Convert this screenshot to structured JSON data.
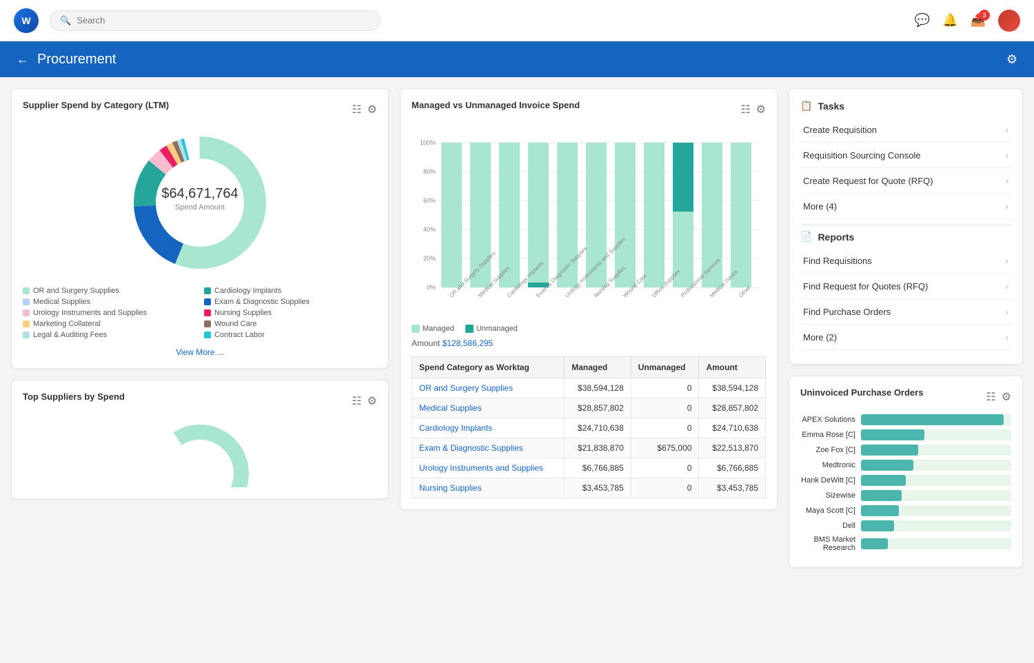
{
  "nav": {
    "logo": "W",
    "search_placeholder": "Search",
    "badge_count": "3"
  },
  "header": {
    "title": "Procurement"
  },
  "supplier_spend": {
    "title": "Supplier Spend by Category (LTM)",
    "amount": "$64,671,764",
    "amount_label": "Spend Amount",
    "view_more": "View More ...",
    "legend": [
      {
        "label": "OR and Surgery Supplies",
        "color": "#a8e6cf"
      },
      {
        "label": "Cardiology Implants",
        "color": "#26a69a"
      },
      {
        "label": "Medical Supplies",
        "color": "#b3d4f5"
      },
      {
        "label": "Exam & Diagnostic Supplies",
        "color": "#1565c0"
      },
      {
        "label": "Urology Instruments and Supplies",
        "color": "#f8bbd0"
      },
      {
        "label": "Nursing Supplies",
        "color": "#e91e63"
      },
      {
        "label": "Marketing Collateral",
        "color": "#ffcc80"
      },
      {
        "label": "Wound Care",
        "color": "#8d6e63"
      },
      {
        "label": "Legal & Auditing Fees",
        "color": "#b0e0e6"
      },
      {
        "label": "Contract Labor",
        "color": "#26c6da"
      }
    ]
  },
  "managed_unmanaged": {
    "title": "Managed vs Unmanaged Invoice Spend",
    "amount_label": "Amount",
    "amount_value": "$128,586,295",
    "legend_managed": "Managed",
    "legend_unmanaged": "Unmanaged",
    "categories": [
      "OR and Surgery Supplies",
      "Medical Supplies",
      "Cardiology Implants",
      "Exam & Diagnostic Supplies",
      "Urology Instruments and Supplies",
      "Nursing Supplies",
      "Wound Care",
      "Office Supplies",
      "Professional Services",
      "Medical Gases",
      "Other"
    ],
    "managed_pct": [
      100,
      100,
      100,
      97,
      100,
      100,
      100,
      100,
      55,
      100,
      100
    ],
    "unmanaged_pct": [
      0,
      0,
      0,
      3,
      0,
      0,
      0,
      0,
      45,
      0,
      0
    ],
    "table_headers": [
      "Spend Category as Worktag",
      "Managed",
      "Unmanaged",
      "Amount"
    ],
    "table_rows": [
      {
        "category": "OR and Surgery Supplies",
        "managed": "$38,594,128",
        "unmanaged": "0",
        "amount": "$38,594,128"
      },
      {
        "category": "Medical Supplies",
        "managed": "$28,857,802",
        "unmanaged": "0",
        "amount": "$28,857,802"
      },
      {
        "category": "Cardiology Implants",
        "managed": "$24,710,638",
        "unmanaged": "0",
        "amount": "$24,710,638"
      },
      {
        "category": "Exam & Diagnostic Supplies",
        "managed": "$21,838,870",
        "unmanaged": "$675,000",
        "amount": "$22,513,870"
      },
      {
        "category": "Urology Instruments and Supplies",
        "managed": "$6,766,885",
        "unmanaged": "0",
        "amount": "$6,766,885"
      },
      {
        "category": "Nursing Supplies",
        "managed": "$3,453,785",
        "unmanaged": "0",
        "amount": "$3,453,785"
      }
    ]
  },
  "tasks": {
    "section_title": "Tasks",
    "items": [
      {
        "label": "Create Requisition"
      },
      {
        "label": "Requisition Sourcing Console"
      },
      {
        "label": "Create Request for Quote (RFQ)"
      },
      {
        "label": "More (4)"
      }
    ]
  },
  "reports": {
    "section_title": "Reports",
    "items": [
      {
        "label": "Find Requisitions"
      },
      {
        "label": "Find Request for Quotes (RFQ)"
      },
      {
        "label": "Find Purchase Orders"
      },
      {
        "label": "More (2)"
      }
    ]
  },
  "uninvoiced_po": {
    "title": "Uninvoiced Purchase Orders",
    "bars": [
      {
        "label": "APEX Solutions",
        "pct": 95
      },
      {
        "label": "Emma Rose [C]",
        "pct": 42
      },
      {
        "label": "Zoe Fox [C]",
        "pct": 38
      },
      {
        "label": "Medtronic",
        "pct": 35
      },
      {
        "label": "Hank DeWitt [C]",
        "pct": 30
      },
      {
        "label": "Sizewise",
        "pct": 27
      },
      {
        "label": "Maya Scott [C]",
        "pct": 25
      },
      {
        "label": "Dell",
        "pct": 22
      },
      {
        "label": "BMS Market Research",
        "pct": 18
      }
    ]
  },
  "top_suppliers": {
    "title": "Top Suppliers by Spend"
  }
}
